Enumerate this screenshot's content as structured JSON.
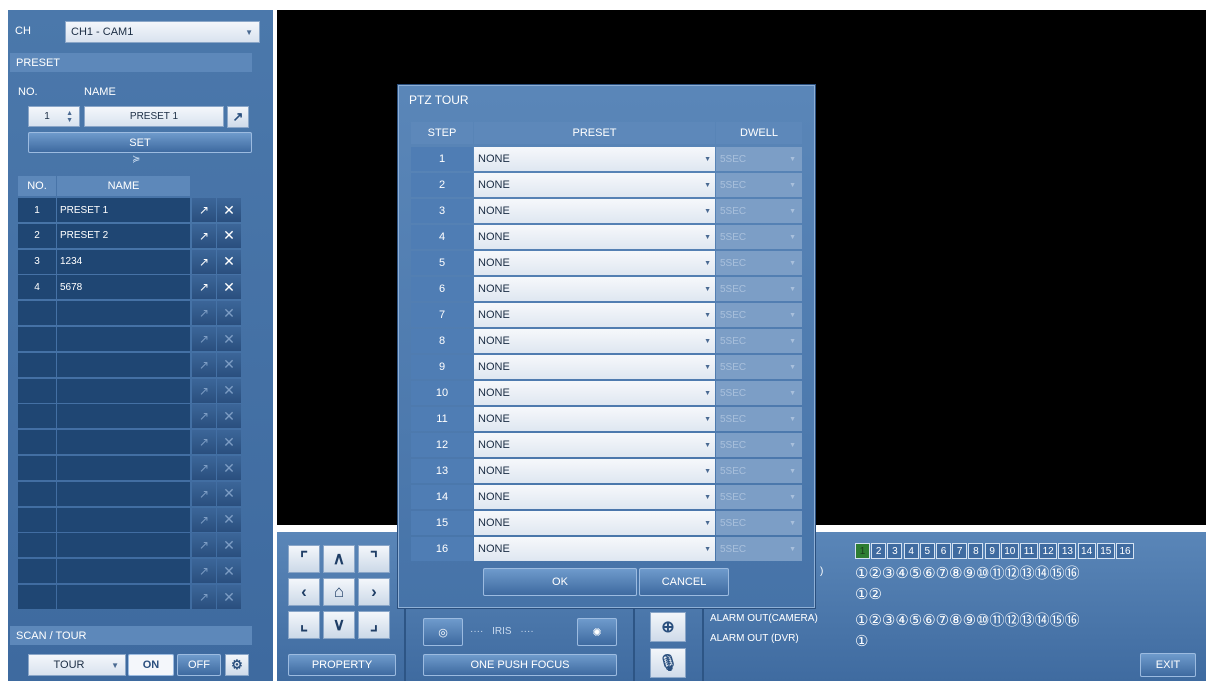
{
  "left_panel": {
    "ch_label": "CH",
    "ch_value": "CH1 - CAM1",
    "preset_header": "PRESET",
    "no_label": "NO.",
    "name_label": "NAME",
    "stepper_value": "1",
    "name_value": "PRESET 1",
    "set_button": "SET",
    "table_no": "NO.",
    "table_name": "NAME",
    "presets": [
      {
        "no": "1",
        "name": "PRESET 1"
      },
      {
        "no": "2",
        "name": "PRESET 2"
      },
      {
        "no": "3",
        "name": "1234"
      },
      {
        "no": "4",
        "name": "5678"
      },
      {
        "no": "",
        "name": ""
      },
      {
        "no": "",
        "name": ""
      },
      {
        "no": "",
        "name": ""
      },
      {
        "no": "",
        "name": ""
      },
      {
        "no": "",
        "name": ""
      },
      {
        "no": "",
        "name": ""
      },
      {
        "no": "",
        "name": ""
      },
      {
        "no": "",
        "name": ""
      },
      {
        "no": "",
        "name": ""
      },
      {
        "no": "",
        "name": ""
      },
      {
        "no": "",
        "name": ""
      },
      {
        "no": "",
        "name": ""
      }
    ],
    "scan_header": "SCAN / TOUR",
    "scan_value": "TOUR",
    "on_button": "ON",
    "off_button": "OFF"
  },
  "dialog": {
    "title": "PTZ TOUR",
    "col_step": "STEP",
    "col_preset": "PRESET",
    "col_dwell": "DWELL",
    "rows": [
      {
        "step": "1",
        "preset": "NONE",
        "dwell": "5SEC"
      },
      {
        "step": "2",
        "preset": "NONE",
        "dwell": "5SEC"
      },
      {
        "step": "3",
        "preset": "NONE",
        "dwell": "5SEC"
      },
      {
        "step": "4",
        "preset": "NONE",
        "dwell": "5SEC"
      },
      {
        "step": "5",
        "preset": "NONE",
        "dwell": "5SEC"
      },
      {
        "step": "6",
        "preset": "NONE",
        "dwell": "5SEC"
      },
      {
        "step": "7",
        "preset": "NONE",
        "dwell": "5SEC"
      },
      {
        "step": "8",
        "preset": "NONE",
        "dwell": "5SEC"
      },
      {
        "step": "9",
        "preset": "NONE",
        "dwell": "5SEC"
      },
      {
        "step": "10",
        "preset": "NONE",
        "dwell": "5SEC"
      },
      {
        "step": "11",
        "preset": "NONE",
        "dwell": "5SEC"
      },
      {
        "step": "12",
        "preset": "NONE",
        "dwell": "5SEC"
      },
      {
        "step": "13",
        "preset": "NONE",
        "dwell": "5SEC"
      },
      {
        "step": "14",
        "preset": "NONE",
        "dwell": "5SEC"
      },
      {
        "step": "15",
        "preset": "NONE",
        "dwell": "5SEC"
      },
      {
        "step": "16",
        "preset": "NONE",
        "dwell": "5SEC"
      }
    ],
    "ok": "OK",
    "cancel": "CANCEL"
  },
  "bottom": {
    "property": "PROPERTY",
    "iris": "IRIS",
    "one_push_focus": "ONE PUSH FOCUS",
    "alarm_in_partial": "A)",
    "alarm_in_partial2": ")",
    "alarm_out_camera": "ALARM OUT(CAMERA)",
    "alarm_out_dvr": "ALARM OUT (DVR)",
    "channels": [
      "1",
      "2",
      "3",
      "4",
      "5",
      "6",
      "7",
      "8",
      "9",
      "10",
      "11",
      "12",
      "13",
      "14",
      "15",
      "16"
    ],
    "active_channel": "1",
    "alarm_row1": "①②③④⑤⑥⑦⑧⑨⑩⑪⑫⑬⑭⑮⑯",
    "alarm_row2": "①②",
    "alarm_row3": "①②③④⑤⑥⑦⑧⑨⑩⑪⑫⑬⑭⑮⑯",
    "alarm_row4": "①",
    "exit": "EXIT"
  },
  "colors": {
    "accent": "#4b78ab",
    "active_channel": "#2e7d32"
  }
}
